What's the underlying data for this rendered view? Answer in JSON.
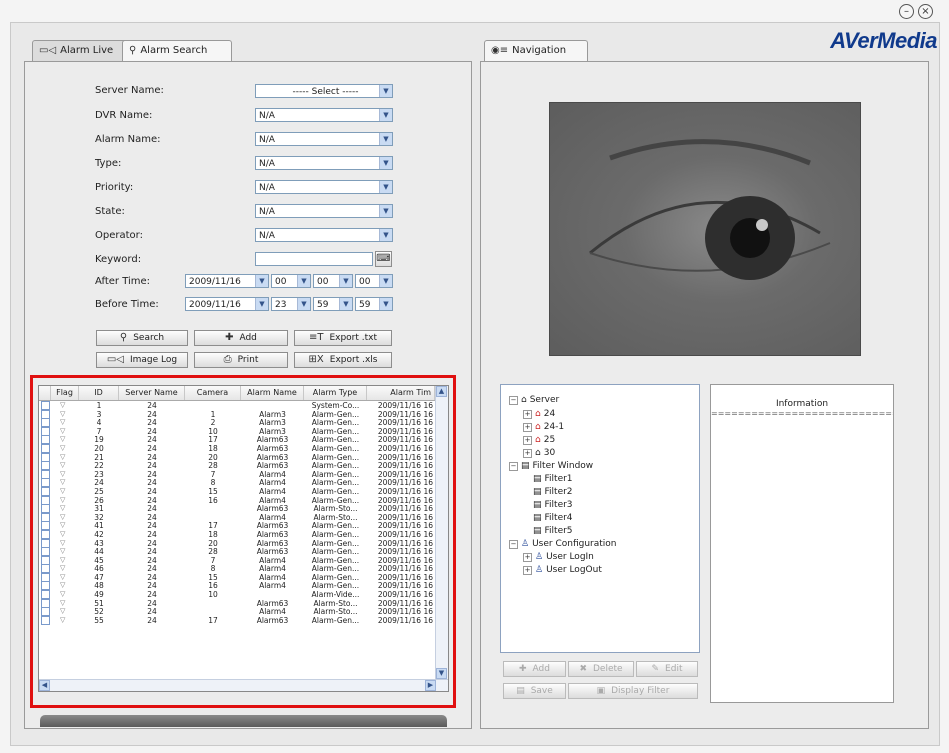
{
  "window": {
    "minimize_glyph": "–",
    "close_glyph": "×",
    "logo": "AVerMedia"
  },
  "tabs": {
    "alarm_live": "Alarm Live",
    "alarm_search": "Alarm Search",
    "navigation": "Navigation"
  },
  "form": {
    "server_name": {
      "label": "Server Name:",
      "value": "----- Select -----"
    },
    "dvr_name": {
      "label": "DVR Name:",
      "value": "N/A"
    },
    "alarm_name": {
      "label": "Alarm Name:",
      "value": "N/A"
    },
    "type": {
      "label": "Type:",
      "value": "N/A"
    },
    "priority": {
      "label": "Priority:",
      "value": "N/A"
    },
    "state": {
      "label": "State:",
      "value": "N/A"
    },
    "operator": {
      "label": "Operator:",
      "value": "N/A"
    },
    "keyword": {
      "label": "Keyword:",
      "value": ""
    },
    "after_time": {
      "label": "After Time:",
      "date": "2009/11/16",
      "h": "00",
      "m": "00",
      "s": "00"
    },
    "before_time": {
      "label": "Before Time:",
      "date": "2009/11/16",
      "h": "23",
      "m": "59",
      "s": "59"
    }
  },
  "buttons": {
    "search": "Search",
    "add": "Add",
    "export_txt": "Export .txt",
    "image_log": "Image Log",
    "print": "Print",
    "export_xls": "Export .xls"
  },
  "table": {
    "headers": [
      "Flag",
      "ID",
      "Server Name",
      "Camera",
      "Alarm Name",
      "Alarm Type",
      "Alarm Tim"
    ],
    "rows": [
      [
        "1",
        "24",
        "",
        "",
        "System-Co...",
        "2009/11/16 16"
      ],
      [
        "3",
        "24",
        "1",
        "Alarm3",
        "Alarm-Gen...",
        "2009/11/16 16"
      ],
      [
        "4",
        "24",
        "2",
        "Alarm3",
        "Alarm-Gen...",
        "2009/11/16 16"
      ],
      [
        "7",
        "24",
        "10",
        "Alarm3",
        "Alarm-Gen...",
        "2009/11/16 16"
      ],
      [
        "19",
        "24",
        "17",
        "Alarm63",
        "Alarm-Gen...",
        "2009/11/16 16"
      ],
      [
        "20",
        "24",
        "18",
        "Alarm63",
        "Alarm-Gen...",
        "2009/11/16 16"
      ],
      [
        "21",
        "24",
        "20",
        "Alarm63",
        "Alarm-Gen...",
        "2009/11/16 16"
      ],
      [
        "22",
        "24",
        "28",
        "Alarm63",
        "Alarm-Gen...",
        "2009/11/16 16"
      ],
      [
        "23",
        "24",
        "7",
        "Alarm4",
        "Alarm-Gen...",
        "2009/11/16 16"
      ],
      [
        "24",
        "24",
        "8",
        "Alarm4",
        "Alarm-Gen...",
        "2009/11/16 16"
      ],
      [
        "25",
        "24",
        "15",
        "Alarm4",
        "Alarm-Gen...",
        "2009/11/16 16"
      ],
      [
        "26",
        "24",
        "16",
        "Alarm4",
        "Alarm-Gen...",
        "2009/11/16 16"
      ],
      [
        "31",
        "24",
        "",
        "Alarm63",
        "Alarm-Sto...",
        "2009/11/16 16"
      ],
      [
        "32",
        "24",
        "",
        "Alarm4",
        "Alarm-Sto...",
        "2009/11/16 16"
      ],
      [
        "41",
        "24",
        "17",
        "Alarm63",
        "Alarm-Gen...",
        "2009/11/16 16"
      ],
      [
        "42",
        "24",
        "18",
        "Alarm63",
        "Alarm-Gen...",
        "2009/11/16 16"
      ],
      [
        "43",
        "24",
        "20",
        "Alarm63",
        "Alarm-Gen...",
        "2009/11/16 16"
      ],
      [
        "44",
        "24",
        "28",
        "Alarm63",
        "Alarm-Gen...",
        "2009/11/16 16"
      ],
      [
        "45",
        "24",
        "7",
        "Alarm4",
        "Alarm-Gen...",
        "2009/11/16 16"
      ],
      [
        "46",
        "24",
        "8",
        "Alarm4",
        "Alarm-Gen...",
        "2009/11/16 16"
      ],
      [
        "47",
        "24",
        "15",
        "Alarm4",
        "Alarm-Gen...",
        "2009/11/16 16"
      ],
      [
        "48",
        "24",
        "16",
        "Alarm4",
        "Alarm-Gen...",
        "2009/11/16 16"
      ],
      [
        "49",
        "24",
        "10",
        "",
        "Alarm-Vide...",
        "2009/11/16 16"
      ],
      [
        "51",
        "24",
        "",
        "Alarm63",
        "Alarm-Sto...",
        "2009/11/16 16"
      ],
      [
        "52",
        "24",
        "",
        "Alarm4",
        "Alarm-Sto...",
        "2009/11/16 16"
      ],
      [
        "55",
        "24",
        "17",
        "Alarm63",
        "Alarm-Gen...",
        "2009/11/16 16"
      ]
    ]
  },
  "tree": {
    "server": "Server",
    "dvr_24": "24",
    "dvr_24_1": "24-1",
    "dvr_25": "25",
    "dvr_30": "30",
    "filter_window": "Filter Window",
    "filter1": "Filter1",
    "filter2": "Filter2",
    "filter3": "Filter3",
    "filter4": "Filter4",
    "filter5": "Filter5",
    "user_configuration": "User Configuration",
    "user_login": "User LogIn",
    "user_logout": "User LogOut"
  },
  "nav_buttons": {
    "add": "Add",
    "delete": "Delete",
    "edit": "Edit",
    "save": "Save",
    "display_filter": "Display Filter"
  },
  "info": {
    "title": "Information",
    "rule": "================================"
  },
  "colors": {
    "highlight": "#e01010",
    "logo": "#103a8c"
  }
}
